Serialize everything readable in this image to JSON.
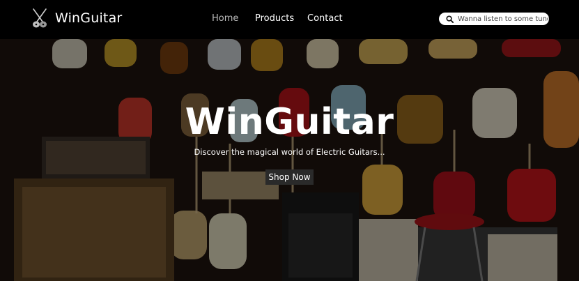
{
  "navbar": {
    "brand": "WinGuitar",
    "brand_icon": "crossed-guitars-icon",
    "links": [
      {
        "label": "Home",
        "active": true
      },
      {
        "label": "Products",
        "active": false
      },
      {
        "label": "Contact",
        "active": false
      }
    ],
    "search": {
      "placeholder": "Wanna listen to some tunes?",
      "value": "",
      "icon": "search-icon"
    }
  },
  "hero": {
    "title": "WinGuitar",
    "subtitle": "Discover the magical world of Electric Guitars...",
    "cta_label": "Shop Now",
    "background": "wall of electric guitars and amplifiers"
  },
  "colors": {
    "navbar_bg": "#000000",
    "active_link": "#bdbdbd",
    "button_bg": "#2a2a2a",
    "search_bg": "#ffffff"
  }
}
